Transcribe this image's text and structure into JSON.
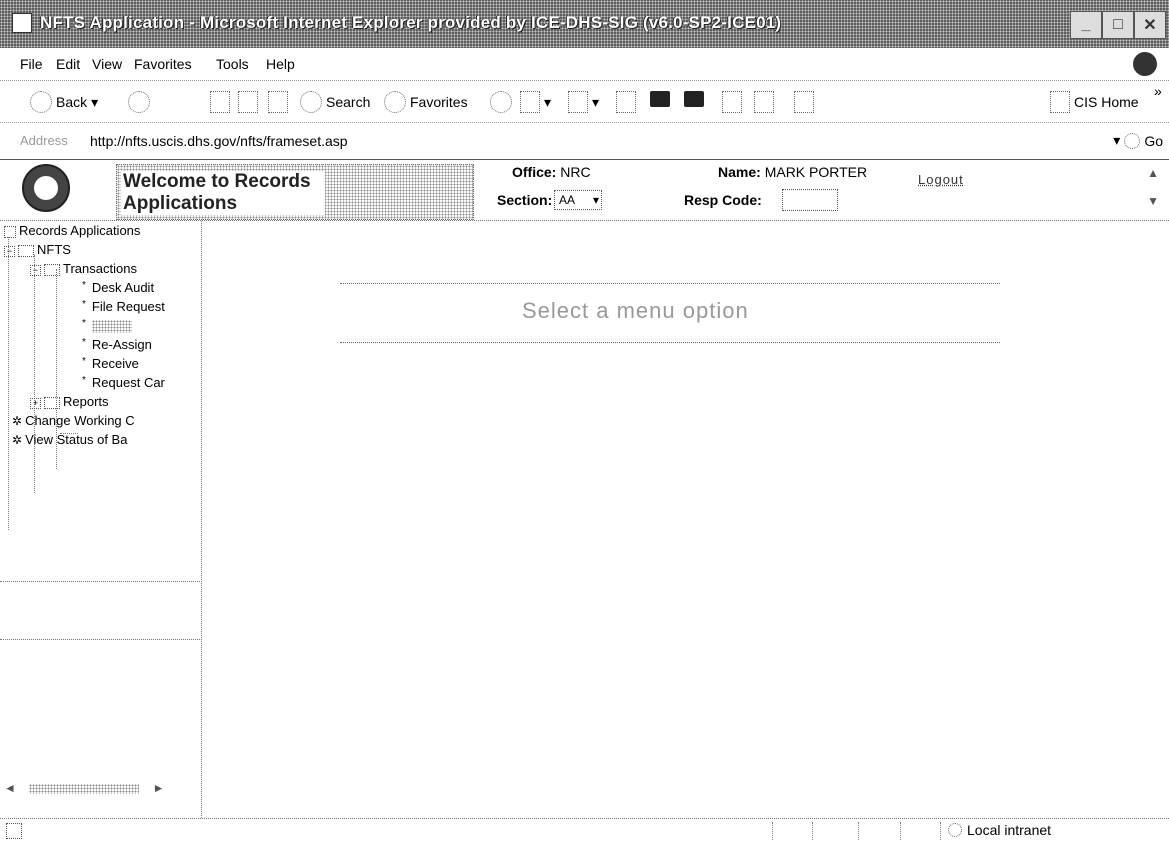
{
  "window": {
    "title": "NFTS Application - Microsoft Internet Explorer provided by ICE-DHS-SIG (v6.0-SP2-ICE01)"
  },
  "menu": [
    "File",
    "Edit",
    "View",
    "Favorites",
    "Tools",
    "Help"
  ],
  "toolbar": {
    "back": "Back",
    "search": "Search",
    "favorites": "Favorites",
    "cis_home": "CIS Home"
  },
  "address": {
    "label": "Address",
    "url": "http://nfts.uscis.dhs.gov/nfts/frameset.asp",
    "go": "Go"
  },
  "header": {
    "welcome": "Welcome to Records Applications",
    "office_label": "Office:",
    "office_value": "NRC",
    "name_label": "Name:",
    "name_value": "MARK PORTER",
    "section_label": "Section:",
    "section_value": "AA",
    "resp_label": "Resp Code:",
    "logout": "Logout"
  },
  "tree": {
    "root": "Records Applications",
    "nfts": "NFTS",
    "transactions": "Transactions",
    "desk_audit": "Desk Audit",
    "file_request": "File Request",
    "reassign": "Re-Assign",
    "receive": "Receive",
    "request_car": "Request Car",
    "reports": "Reports",
    "change_working": "Change Working C",
    "view_status": "View Status of Ba"
  },
  "main": {
    "message": "Select a menu option"
  },
  "status": {
    "zone": "Local intranet"
  }
}
